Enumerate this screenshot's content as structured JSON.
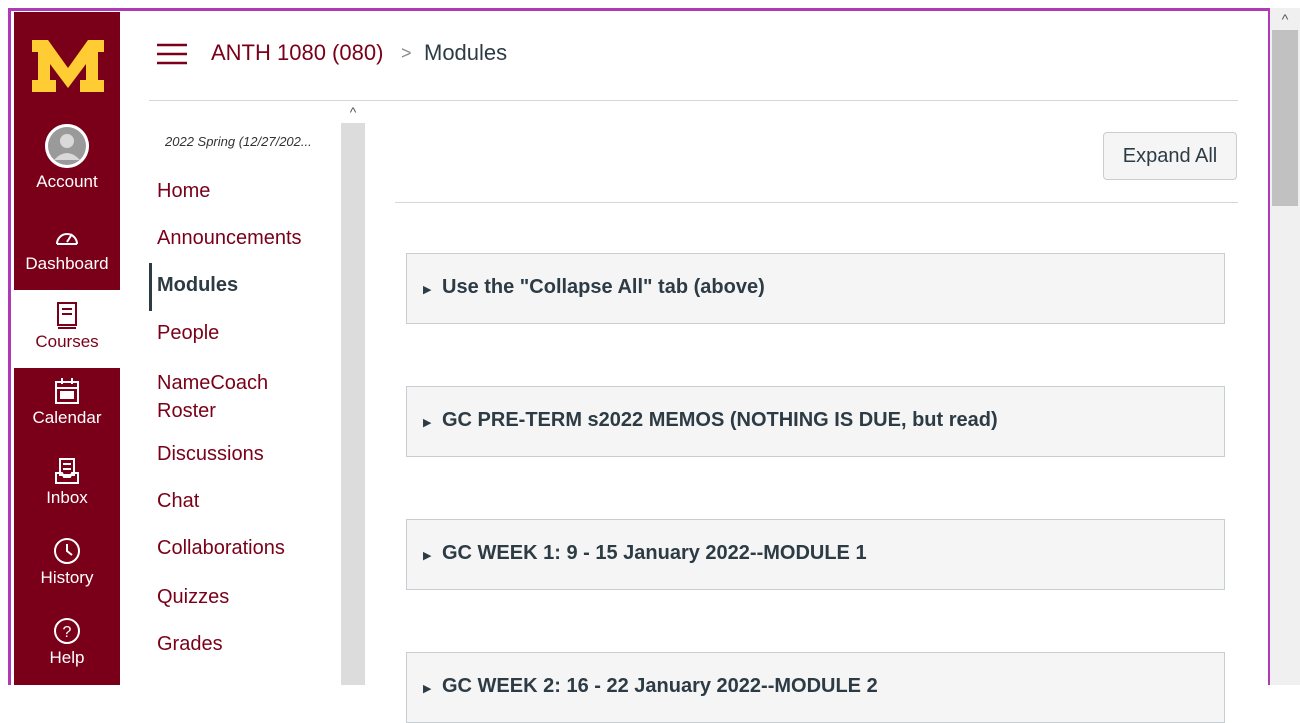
{
  "global_nav": {
    "items": [
      {
        "label": "Account",
        "icon": "account-avatar"
      },
      {
        "label": "Dashboard",
        "icon": "dashboard-gauge-icon"
      },
      {
        "label": "Courses",
        "icon": "courses-book-icon",
        "active": true
      },
      {
        "label": "Calendar",
        "icon": "calendar-icon"
      },
      {
        "label": "Inbox",
        "icon": "inbox-icon"
      },
      {
        "label": "History",
        "icon": "history-clock-icon"
      },
      {
        "label": "Help",
        "icon": "help-question-icon"
      }
    ],
    "colors": {
      "background": "#7a0019",
      "logo_gold": "#ffcc33"
    }
  },
  "breadcrumb": {
    "course": "ANTH 1080 (080)",
    "separator": ">",
    "current": "Modules"
  },
  "course_nav": {
    "term": "2022 Spring (12/27/202...",
    "links": [
      {
        "label": "Home"
      },
      {
        "label": "Announcements"
      },
      {
        "label": "Modules",
        "active": true
      },
      {
        "label": "People"
      },
      {
        "label": "NameCoach\nRoster"
      },
      {
        "label": "Discussions"
      },
      {
        "label": "Chat"
      },
      {
        "label": "Collaborations"
      },
      {
        "label": "Quizzes"
      },
      {
        "label": "Grades"
      }
    ]
  },
  "content": {
    "expand_all_label": "Expand All",
    "modules": [
      {
        "title": "Use the \"Collapse All\" tab (above)"
      },
      {
        "title": "GC PRE-TERM s2022 MEMOS (NOTHING IS DUE, but read)"
      },
      {
        "title": "GC WEEK 1: 9 - 15 January 2022--MODULE 1"
      },
      {
        "title": "GC WEEK 2: 16 - 22 January 2022--MODULE 2"
      }
    ]
  },
  "accent_colors": {
    "brand": "#7a0019",
    "frame": "#b03ab6",
    "text_dark": "#2d3b45"
  }
}
